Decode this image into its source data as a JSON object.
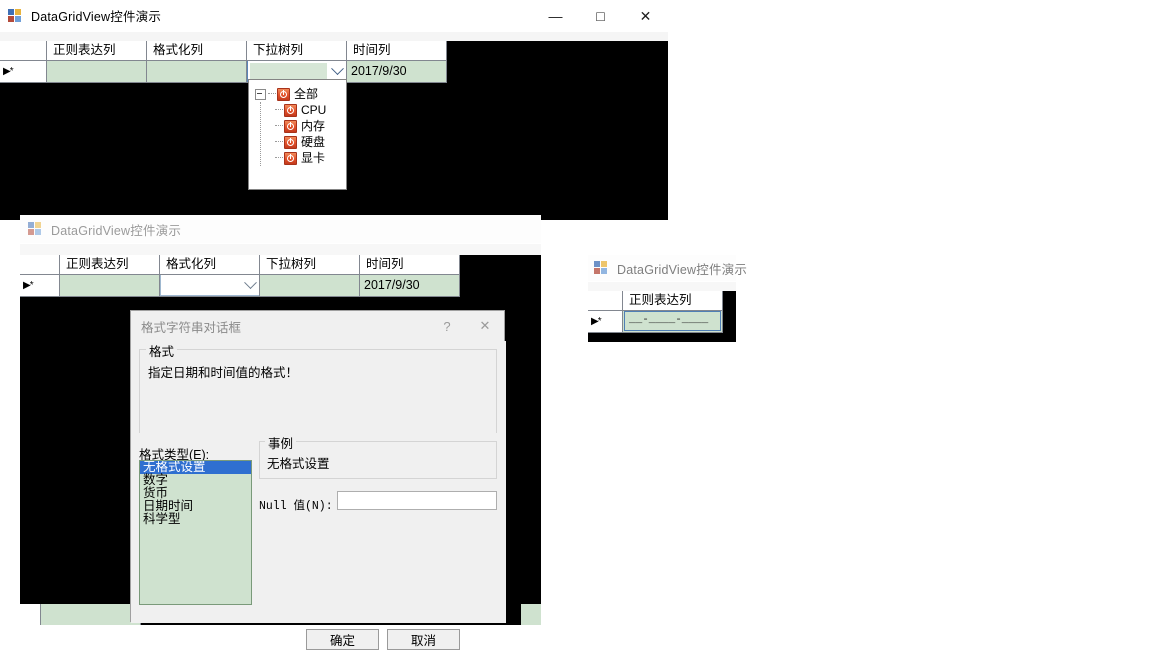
{
  "main_window": {
    "title": "DataGridView控件演示",
    "icon": "app-icon",
    "buttons": {
      "minimize": "—",
      "maximize": "□",
      "close": "✕"
    },
    "grid": {
      "columns": [
        "",
        "正则表达列",
        "格式化列",
        "下拉树列",
        "时间列"
      ],
      "row_header_marker": "▶*",
      "row": {
        "regex_value": "",
        "format_value": "",
        "tree_value": "",
        "time_value": "2017/9/30"
      }
    },
    "tree_popup": {
      "root": {
        "label": "全部",
        "icon": "power-node-icon",
        "expanded": true
      },
      "children": [
        {
          "label": "CPU",
          "icon": "power-node-icon"
        },
        {
          "label": "内存",
          "icon": "power-node-icon"
        },
        {
          "label": "硬盘",
          "icon": "power-node-icon"
        },
        {
          "label": "显卡",
          "icon": "power-node-icon"
        }
      ]
    }
  },
  "second_window": {
    "title": "DataGridView控件演示",
    "grid": {
      "columns": [
        "",
        "正则表达列",
        "格式化列",
        "下拉树列",
        "时间列"
      ],
      "row_header_marker": "▶*",
      "row": {
        "regex_value": "",
        "format_value": "",
        "tree_value": "",
        "time_value": "2017/9/30"
      }
    }
  },
  "third_window": {
    "title": "DataGridView控件演示",
    "grid": {
      "columns": [
        "",
        "正则表达列"
      ],
      "row_header_marker": "▶*",
      "row": {
        "regex_value": "__-____-____"
      }
    }
  },
  "dialog": {
    "title": "格式字符串对话框",
    "help_glyph": "?",
    "close_glyph": "✕",
    "format_group_title": "格式",
    "format_description": "指定日期和时间值的格式！",
    "format_type_label": "格式类型(E):",
    "format_types": [
      "无格式设置",
      "数字",
      "货币",
      "日期时间",
      "科学型"
    ],
    "selected_format_type": "无格式设置",
    "sample_group_title": "事例",
    "sample_text": "无格式设置",
    "null_label": "Null 值(N):",
    "null_value": "",
    "ok_label": "确定",
    "cancel_label": "取消"
  },
  "colors": {
    "cell_green": "#cfe2cf",
    "selection_blue": "#2f6fd0",
    "node_orange": "#e2502a",
    "grid_line": "#828790",
    "dialog_face": "#f0f0f0"
  }
}
